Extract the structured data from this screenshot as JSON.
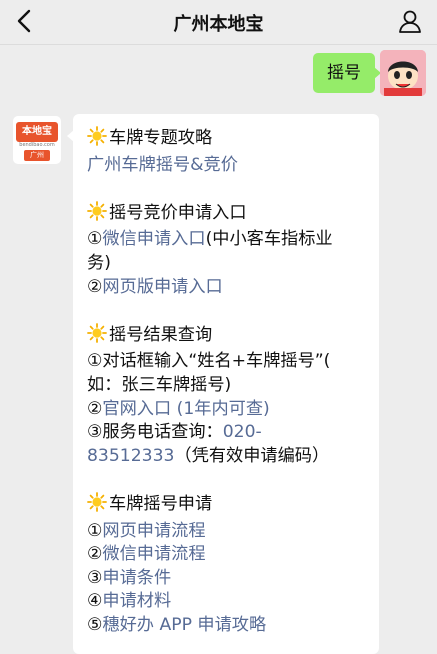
{
  "header": {
    "title": "广州本地宝"
  },
  "user_message": {
    "text": "摇号"
  },
  "bot_avatar": {
    "brand": "本地宝",
    "site": "bendibao.com",
    "city": "广州"
  },
  "bot_message": {
    "s1": {
      "title": "车牌专题攻略",
      "link": "广州车牌摇号&竞价"
    },
    "s2": {
      "title": "摇号竞价申请入口",
      "i1_num": "①",
      "i1_link": "微信申请入口",
      "i1_text_a": "(中小客车指标业",
      "i1_text_b": "务)",
      "i2_num": "②",
      "i2_link": "网页版申请入口"
    },
    "s3": {
      "title": "摇号结果查询",
      "i1_a": "①对话框输入“姓名+车牌摇号”(",
      "i1_b": "如：张三车牌摇号)",
      "i2_num": "②",
      "i2_link": "官网入口 (1年内可查)",
      "i3_a": "③服务电话查询：",
      "phone_a": "020-",
      "phone_b": "83512333",
      "i3_note": "（凭有效申请编码）"
    },
    "s4": {
      "title": "车牌摇号申请",
      "items": [
        {
          "num": "①",
          "link": "网页申请流程"
        },
        {
          "num": "②",
          "link": "微信申请流程"
        },
        {
          "num": "③",
          "link": "申请条件"
        },
        {
          "num": "④",
          "link": "申请材料"
        },
        {
          "num": "⑤",
          "link": "穗好办 APP 申请攻略"
        }
      ]
    }
  }
}
